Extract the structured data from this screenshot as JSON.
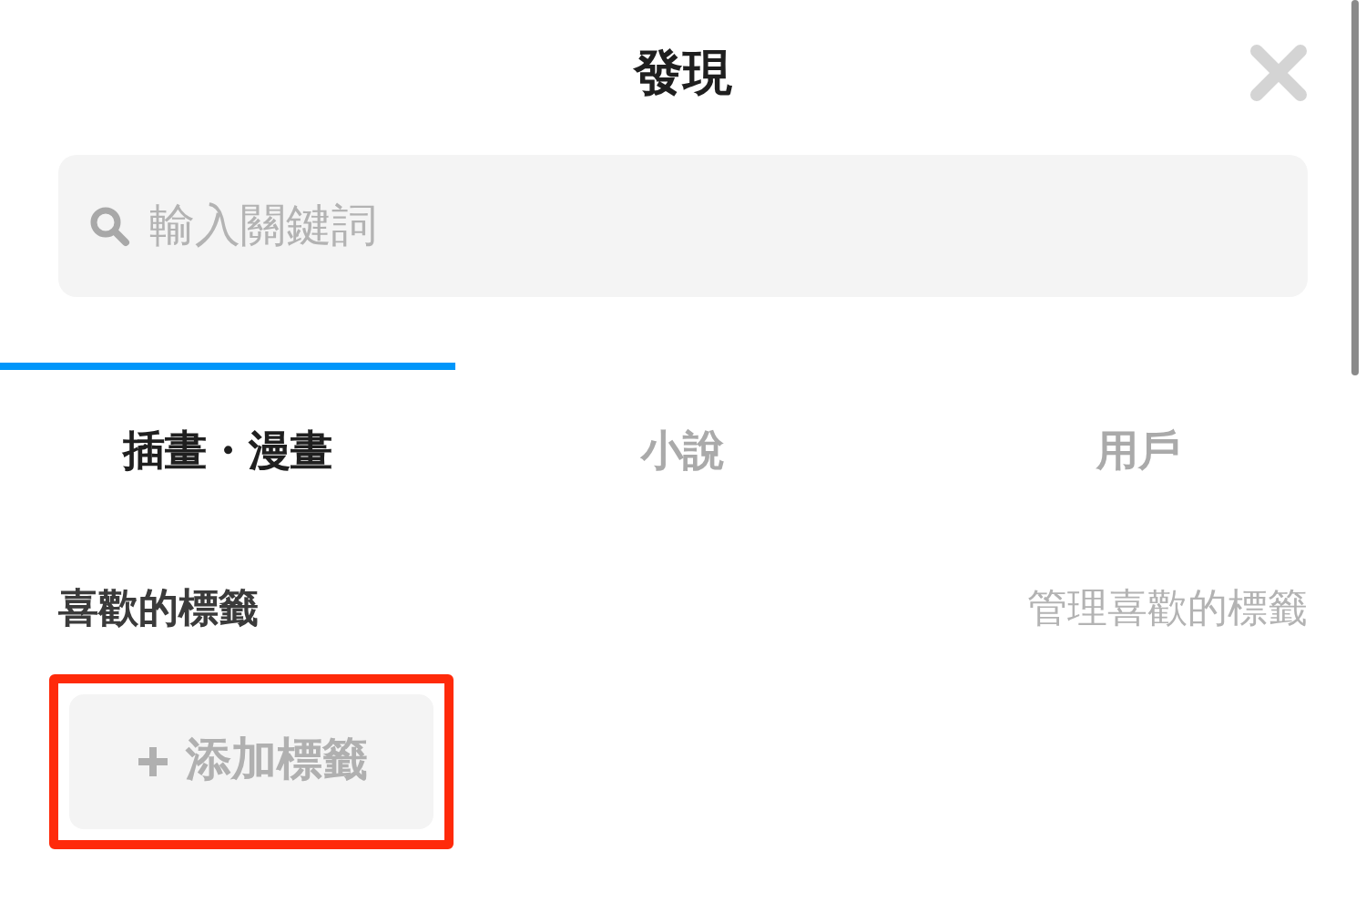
{
  "header": {
    "title": "發現"
  },
  "search": {
    "placeholder": "輸入關鍵詞"
  },
  "tabs": [
    {
      "label": "插畫・漫畫",
      "selected": true
    },
    {
      "label": "小說",
      "selected": false
    },
    {
      "label": "用戶",
      "selected": false
    }
  ],
  "favorite_tags": {
    "title": "喜歡的標籤",
    "manage_link": "管理喜歡的標籤",
    "add_button": {
      "label": "添加標籤",
      "highlighted": true
    }
  }
}
